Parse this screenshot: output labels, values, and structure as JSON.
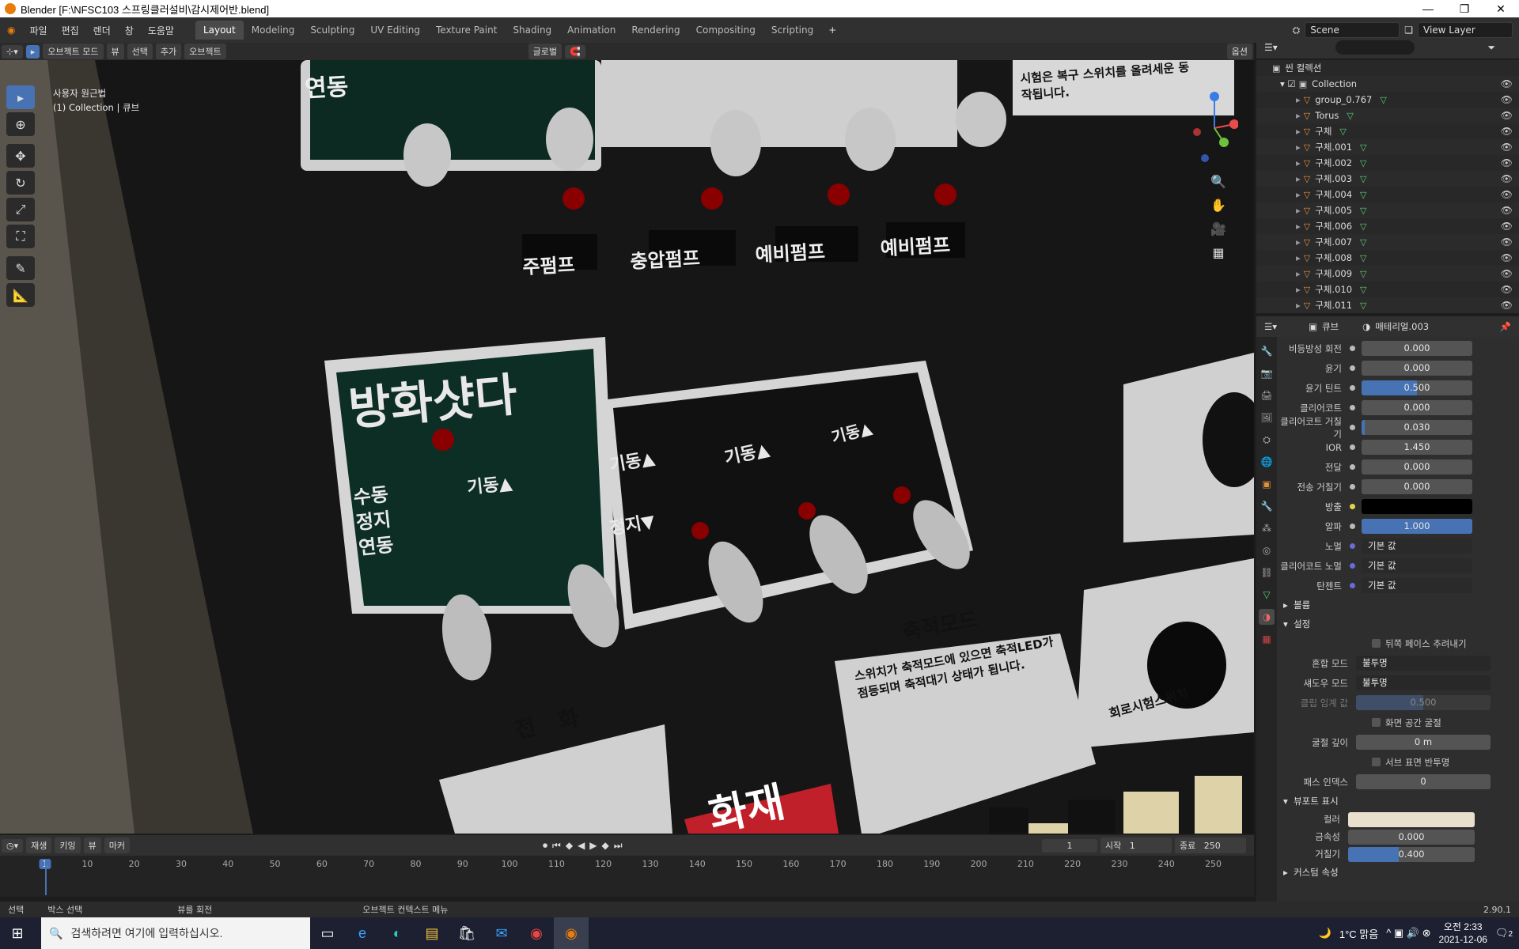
{
  "window": {
    "title": "Blender [F:\\NFSC103 스프링클러설비\\감시제어반.blend]"
  },
  "menu": [
    "파일",
    "편집",
    "렌더",
    "창",
    "도움말"
  ],
  "workspaces": [
    "Layout",
    "Modeling",
    "Sculpting",
    "UV Editing",
    "Texture Paint",
    "Shading",
    "Animation",
    "Rendering",
    "Compositing",
    "Scripting"
  ],
  "active_workspace": "Layout",
  "scene": "Scene",
  "view_layer": "View Layer",
  "viewport": {
    "mode": "오브젝트 모드",
    "menus": [
      "뷰",
      "선택",
      "추가",
      "오브젝트"
    ],
    "transform": "글로벌",
    "options": "옵션",
    "view_name": "사용자 원근법",
    "collection_info": "(1) Collection | 큐브"
  },
  "scene_labels": {
    "main_panel_title": "방화샷다",
    "toggle_left": [
      "수동",
      "정지",
      "연동"
    ],
    "up": "기동▲",
    "down": "정지▼",
    "pumps": [
      "주펌프",
      "충압펌프",
      "예비펌프",
      "예비펌프"
    ],
    "mode_title": "축적모드",
    "mode_text": "스위치가 축적모드에 있으면 축적LED가 점등되며 축적대기 상태가 됩니다.",
    "phone": "전화",
    "fire": "화재",
    "top_right_text": "시험은 복구 스위치를 올려세운 동작됩니다.",
    "dial_left": "회로시험스위치"
  },
  "outliner": {
    "root": "씬 컬렉션",
    "collection": "Collection",
    "items": [
      "group_0.767",
      "Torus",
      "구체",
      "구체.001",
      "구체.002",
      "구체.003",
      "구체.004",
      "구체.005",
      "구체.006",
      "구체.007",
      "구체.008",
      "구체.009",
      "구체.010",
      "구체.011"
    ]
  },
  "properties": {
    "object": "큐브",
    "material": "매테리얼.003",
    "rows": [
      [
        "비등방성 회전",
        "0.000",
        0
      ],
      [
        "윤기",
        "0.000",
        0
      ],
      [
        "윤기 틴트",
        "0.500",
        0.5
      ],
      [
        "클리어코트",
        "0.000",
        0
      ],
      [
        "클리어코트 거칠기",
        "0.030",
        0.03
      ],
      [
        "IOR",
        "1.450",
        0
      ],
      [
        "전달",
        "0.000",
        0
      ],
      [
        "전송 거칠기",
        "0.000",
        0
      ],
      [
        "방출",
        "",
        0
      ],
      [
        "알파",
        "1.000",
        1
      ]
    ],
    "links": [
      [
        "노멀",
        "기본 값"
      ],
      [
        "클리어코트 노멀",
        "기본 값"
      ],
      [
        "탄젠트",
        "기본 값"
      ]
    ],
    "sec_volume": "볼륨",
    "sec_settings": "설정",
    "backface": "뒤쪽 페이스 추려내기",
    "blend_label": "혼합 모드",
    "blend": "불투명",
    "shadow_label": "섀도우 모드",
    "shadow": "불투명",
    "clip_label": "클립 임계 값",
    "clip": "0.500",
    "ss_refr": "화면 공간 굴절",
    "refr_depth_label": "굴절 깊이",
    "refr_depth": "0 m",
    "sss": "서브 표면 반투명",
    "pass_label": "패스 인덱스",
    "pass": "0",
    "sec_viewport": "뷰포트 표시",
    "color_label": "컬러",
    "metal_label": "금속성",
    "metal": "0.000",
    "rough_label": "거칠기",
    "rough": "0.400",
    "rough_v": 0.4,
    "sec_custom": "커스텀 속성"
  },
  "timeline": {
    "menus": [
      "재생",
      "키잉",
      "뷰",
      "마커"
    ],
    "current": "1",
    "start_label": "시작",
    "start": "1",
    "end_label": "종료",
    "end": "250",
    "ticks": [
      1,
      10,
      20,
      30,
      40,
      50,
      60,
      70,
      80,
      90,
      100,
      110,
      120,
      130,
      140,
      150,
      160,
      170,
      180,
      190,
      200,
      210,
      220,
      230,
      240,
      250
    ]
  },
  "status": {
    "select": "선택",
    "box": "박스 선택",
    "rotate": "뷰를 회전",
    "context": "오브젝트 컨텍스트 메뉴",
    "version": "2.90.1"
  },
  "taskbar": {
    "search": "검색하려면 여기에 입력하십시오.",
    "weather": "1°C 맑음",
    "time": "오전 2:33",
    "date": "2021-12-06",
    "notif": "2"
  }
}
